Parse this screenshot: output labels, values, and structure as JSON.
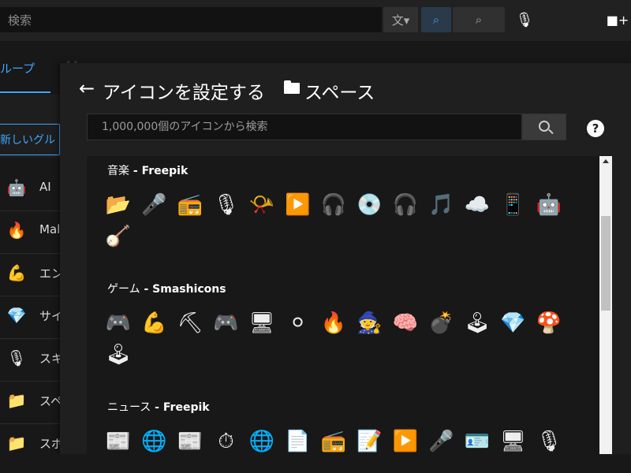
{
  "topbar": {
    "search_placeholder": "検索",
    "translate_icon": "translate-icon",
    "caption_icon": "caption-search-icon",
    "mic_icon": "mic-icon",
    "video_icon": "video-add-icon"
  },
  "background": {
    "tab_label": "ループ",
    "new_group_label": "新しいグル",
    "faded_text": "ˣ ˣ",
    "sidebar_items": [
      {
        "icon": "🤖",
        "label": "AI"
      },
      {
        "icon": "🔥",
        "label": "Mal"
      },
      {
        "icon": "💪",
        "label": "エン"
      },
      {
        "icon": "💎",
        "label": "サイ"
      },
      {
        "icon": "🎙",
        "label": "スキ"
      },
      {
        "icon": "📁",
        "label": "スペ"
      },
      {
        "icon": "📁",
        "label": "スポ"
      }
    ]
  },
  "modal": {
    "title": "アイコンを設定する",
    "folder_label": "スペース",
    "search_placeholder": "1,000,000個のアイコンから検索",
    "help_label": "?"
  },
  "categories": [
    {
      "name": "音楽",
      "author": "Freepik",
      "icons": [
        "📂",
        "🎤",
        "📻",
        "🎙",
        "📯",
        "▶️",
        "🎧",
        "💿",
        "🎧",
        "🎵",
        "☁️",
        "📱",
        "🤖",
        "🪕"
      ]
    },
    {
      "name": "ゲーム",
      "author": "Smashicons",
      "icons": [
        "🎮",
        "💪",
        "⛏",
        "🎮",
        "🖥",
        "⚪",
        "🔥",
        "🧙",
        "🧠",
        "💣",
        "🕹",
        "💎",
        "🍄",
        "🕹"
      ]
    },
    {
      "name": "ニュース",
      "author": "Freepik",
      "icons": [
        "📰",
        "🌐",
        "📰",
        "⏱",
        "🌐",
        "📄",
        "📻",
        "📝",
        "▶️",
        "🎤",
        "🪪",
        "🖥",
        "🎙"
      ]
    }
  ]
}
